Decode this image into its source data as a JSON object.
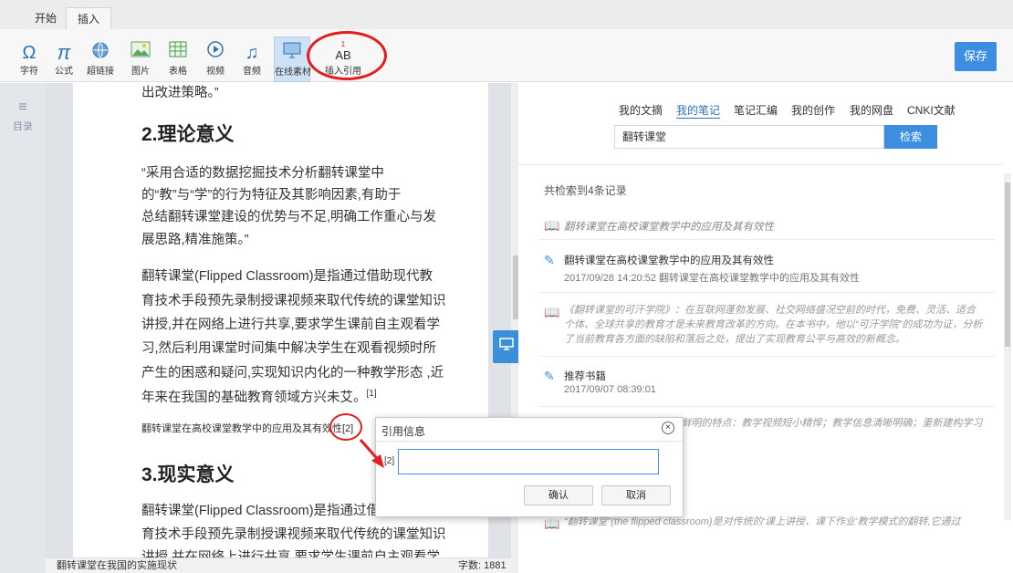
{
  "tabs": {
    "start": "开始",
    "insert": "插入"
  },
  "toolbar": {
    "tools": [
      {
        "glyph": "Ω",
        "label": "字符"
      },
      {
        "glyph": "π",
        "label": "公式"
      },
      {
        "glyph": "🔗",
        "label": "超链接"
      },
      {
        "glyph": "▦",
        "label": "图片"
      },
      {
        "glyph": "⊞",
        "label": "表格"
      },
      {
        "glyph": "▶",
        "label": "视频"
      },
      {
        "glyph": "♫",
        "label": "音频"
      },
      {
        "glyph": "▭",
        "label": "在线素材"
      },
      {
        "glyph": "AB",
        "label": "插入引用"
      }
    ],
    "cite_glyph_sup": "1",
    "save_label": "保存"
  },
  "sidebar": {
    "toc_label": "目录"
  },
  "document": {
    "line0": "出改进策略。”",
    "h2": "2.理论意义",
    "p1": [
      "“采用合适的数据挖掘技术分析翻转课堂中",
      "的“教”与“学”的行为特征及其影响因素,有助于",
      "总结翻转课堂建设的优势与不足,明确工作重心与发",
      "展思路,精准施策。”"
    ],
    "p2": [
      "翻转课堂(Flipped Classroom)是指通过借助现代教",
      "育技术手段预先录制授课视频来取代传统的课堂知识",
      "讲授,并在网络上进行共享,要求学生课前自主观看学",
      "习,然后利用课堂时间集中解决学生在观看视频时所",
      "产生的困惑和疑问,实现知识内化的一种教学形态 ,近",
      "年来在我国的基础教育领域方兴未艾。"
    ],
    "p2_sup": "[1]",
    "ref_line": "翻转课堂在高校课堂教学中的应用及其有效性",
    "ref_mark": "[2]",
    "h3": "3.现实意义",
    "p3": [
      "翻转课堂(Flipped Classroom)是指通过借助现",
      "育技术手段预先录制授课视频来取代传统的课堂知识",
      "讲授,并在网络上进行共享,要求学生课前自主观看学"
    ]
  },
  "status": {
    "left": "翻转课堂在我国的实施现状",
    "right": "字数: 1881"
  },
  "right_panel": {
    "tabs": [
      "我的文摘",
      "我的笔记",
      "笔记汇编",
      "我的创作",
      "我的网盘",
      "CNKI文献"
    ],
    "active_tab": "我的笔记",
    "search_value": "翻转课堂",
    "search_button": "检索",
    "count_text": "共检索到4条记录",
    "items": [
      {
        "title": "翻转课堂在高校课堂教学中的应用及其有效性"
      },
      {
        "title": "翻转课堂在高校课堂教学中的应用及其有效性",
        "sub": "2017/09/28 14:20:52   翻转课堂在高校课堂教学中的应用及其有效性"
      },
      {
        "desc": "《翻转课堂的可汗学院》：在互联网蓬勃发展、社交网络盛况空前的时代，免费、灵活、适合个体、全球共享的教育才是未来教育改革的方向。在本书中，他以“可汗学院”的成功为证，分析了当前教育各方面的缺陷和落后之处，提出了实现教育公平与高效的新概念。"
      },
      {
        "title": "推荐书籍",
        "sub": "2017/09/07 08:39:01"
      },
      {
        "desc": "笔记：“翻转课堂”中的三个鲜明的特点：教学视频短小精悍；教学信息清晰明确；重新建构学习流程；复习检测方便快捷。"
      },
      {
        "desc": "“翻转课堂”(the flipped classroom)是对传统的‘课上讲授、课下作业’教学模式的翻转,它通过"
      }
    ]
  },
  "dialog": {
    "title": "引用信息",
    "prefix": "[2]",
    "input_value": "",
    "ok": "确认",
    "cancel": "取消",
    "close": "×"
  }
}
